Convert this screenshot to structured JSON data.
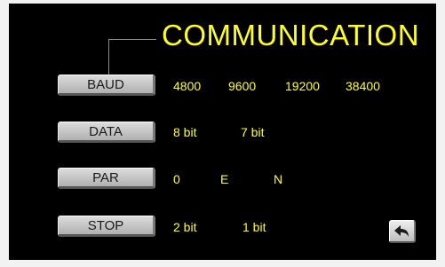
{
  "title": "COMMUNICATION",
  "settings": [
    {
      "label": "BAUD",
      "options": [
        "4800",
        "9600",
        "19200",
        "38400"
      ]
    },
    {
      "label": "DATA",
      "options": [
        "8 bit",
        "7 bit"
      ]
    },
    {
      "label": "PAR",
      "options": [
        "0",
        "E",
        "N"
      ]
    },
    {
      "label": "STOP",
      "options": [
        "2 bit",
        "1 bit"
      ]
    }
  ],
  "icons": {
    "back": "back-arrow-icon"
  },
  "colors": {
    "accent": "#ffff22",
    "background": "#000000"
  }
}
